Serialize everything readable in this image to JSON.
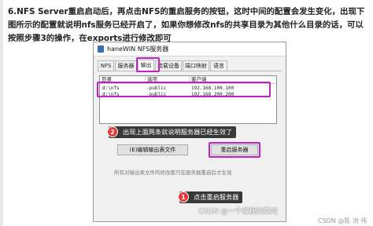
{
  "paragraph": "6.NFS Server重启启动后，再点击NFS的重启服务的按钮，这时中间的配置会发生变化，出现下图所示的配置就说明nfs服务已经开启了，如果你想修改nfs的共享目录为其他什么目录的话，可以按照步骤3的操作，在exports进行修改即可",
  "window": {
    "title": "haneWIN NFS服务器",
    "tabs": [
      "NFS",
      "服务器",
      "输出",
      "挂载设备",
      "端口映射",
      "语言"
    ],
    "active_tab": "输出",
    "columns": [
      "目录",
      "选项",
      "客户端"
    ],
    "rows": [
      {
        "dir": "d:\\nfs",
        "opt": "-public",
        "client": "192.168.100.100"
      },
      {
        "dir": "d:\\nfs",
        "opt": "-public",
        "client": "192.168.200.200"
      }
    ],
    "edit_button": "(E)编辑输出表文件",
    "restart_button": "重启服务器",
    "hint": "所有对输出表文件的修改都只在服务器重启后才生效"
  },
  "annotations": {
    "badge_1": "1",
    "badge_2": "2",
    "callout_1": "点击重启服务器",
    "callout_2": "出现上面两条就说明服务器已经生效了"
  },
  "watermarks": {
    "csdn": "CSDN @一个编程的菜鸡",
    "csdn_right": "CSDN @陈 洪 伟"
  },
  "colors": {
    "highlight": "#c021c0",
    "badge": "#e53935"
  }
}
